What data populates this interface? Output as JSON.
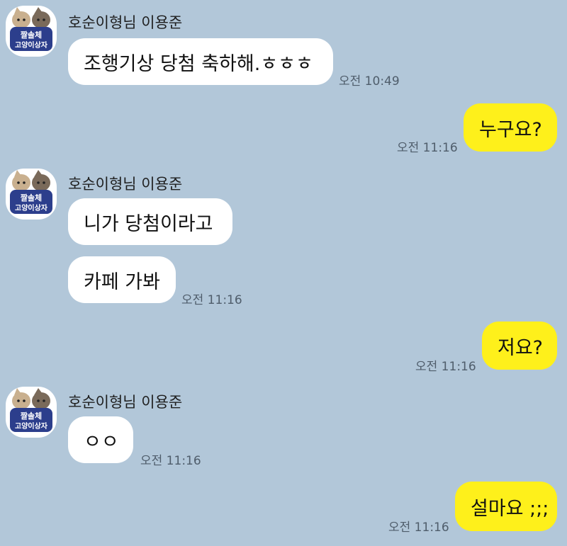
{
  "chat": {
    "sender_name": "호순이형님 이용준",
    "avatar_text": {
      "line1": "짤솔체",
      "line2": "고양이상자"
    },
    "messages": [
      {
        "text": "조행기상 당첨 축하해.ㅎㅎㅎ",
        "time": "오전 10:49"
      },
      {
        "text": "누구요?",
        "time": "오전 11:16"
      },
      {
        "text": "니가 당첨이라고"
      },
      {
        "text": "카페 가봐",
        "time": "오전 11:16"
      },
      {
        "text": "저요?",
        "time": "오전 11:16"
      },
      {
        "text": "ㅇㅇ",
        "time": "오전 11:16"
      },
      {
        "text": "설마요 ;;;",
        "time": "오전 11:16"
      }
    ]
  },
  "colors": {
    "background": "#b2c7d9",
    "incoming_bubble": "#ffffff",
    "outgoing_bubble": "#fef01b"
  }
}
